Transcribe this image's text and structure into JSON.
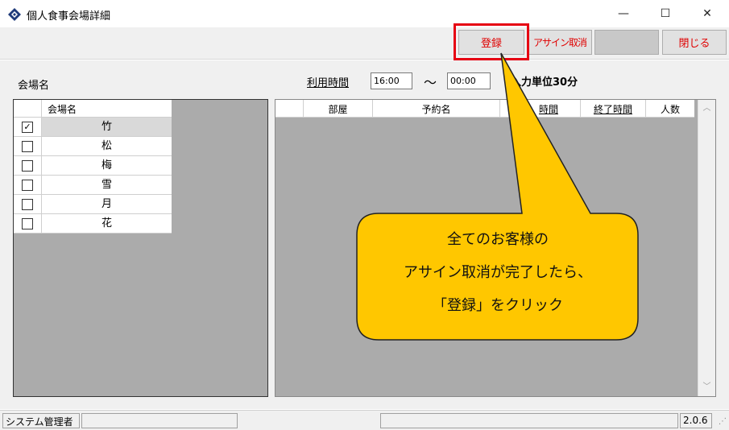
{
  "window": {
    "title": "個人食事会場詳細",
    "minimize_glyph": "—",
    "maximize_glyph": "☐",
    "close_glyph": "✕"
  },
  "toolbar": {
    "register_label": "登録",
    "assign_cancel_label": "アサイン取消",
    "blank_label": "",
    "close_label": "閉じる"
  },
  "filters": {
    "venue_label": "会場名",
    "time_label": "利用時間",
    "time_from": "16:00",
    "tilde": "～",
    "time_to": "00:00",
    "unit_text": "入力単位30分"
  },
  "venue_grid": {
    "header": "会場名",
    "rows": [
      {
        "name": "竹",
        "checked": true
      },
      {
        "name": "松",
        "checked": false
      },
      {
        "name": "梅",
        "checked": false
      },
      {
        "name": "雪",
        "checked": false
      },
      {
        "name": "月",
        "checked": false
      },
      {
        "name": "花",
        "checked": false
      }
    ]
  },
  "reservation_grid": {
    "columns": [
      "部屋",
      "予約名",
      "時間",
      "終了時間",
      "人数"
    ]
  },
  "statusbar": {
    "user": "システム管理者",
    "version": "2.0.6"
  },
  "callout": {
    "lines": [
      "全てのお客様の",
      "アサイン取消が完了したら、",
      "「登録」をクリック"
    ],
    "fill_color": "#FFC700"
  },
  "colors": {
    "highlight": "#E60012",
    "button_text": "#E00000"
  }
}
